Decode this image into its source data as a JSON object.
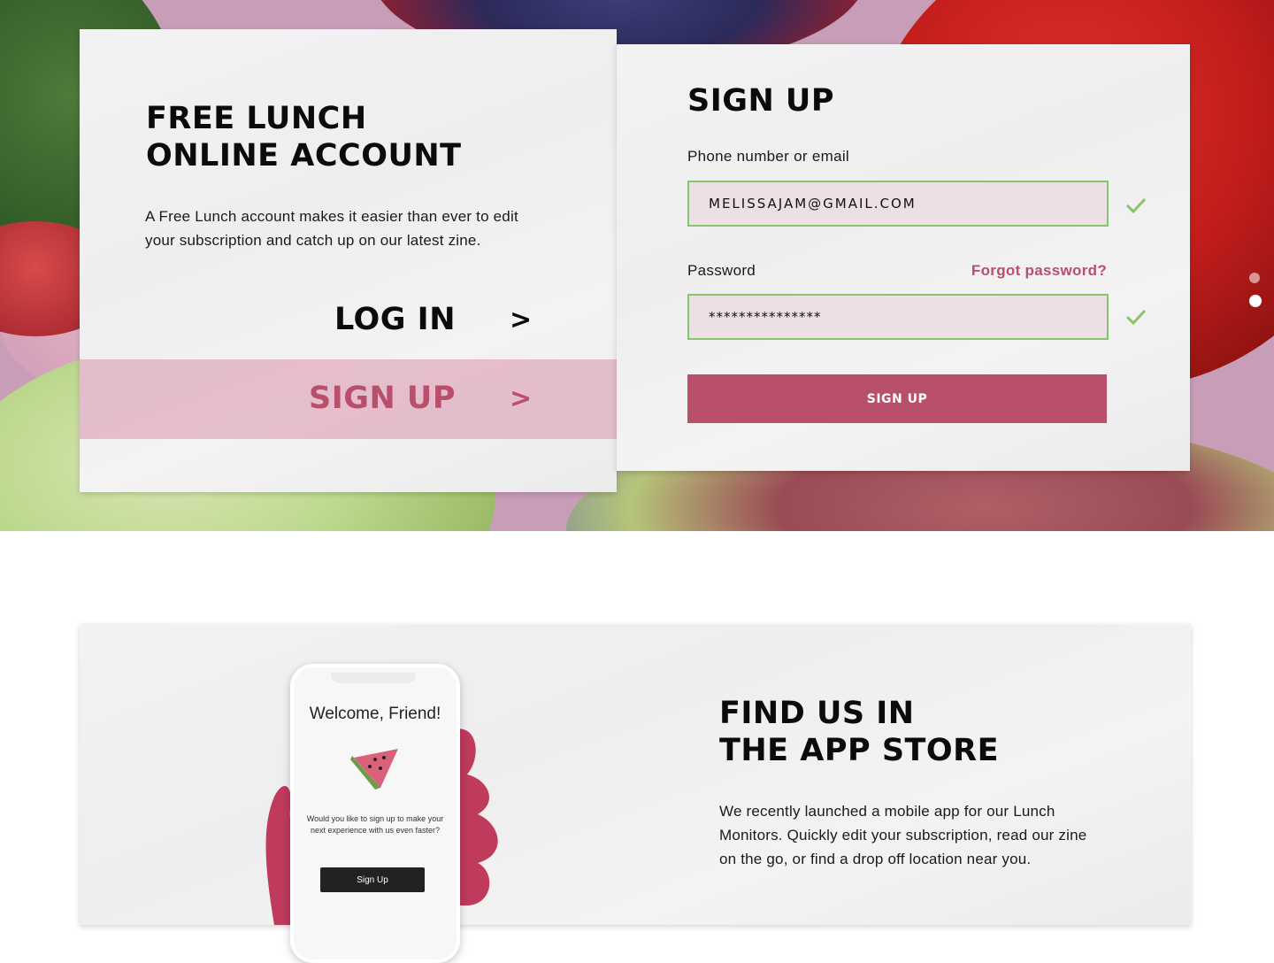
{
  "account_card": {
    "title_line1": "FREE LUNCH",
    "title_line2": "ONLINE ACCOUNT",
    "description": "A Free Lunch account makes it easier than ever to edit your subscription and catch up on our latest zine.",
    "login_label": "LOG IN",
    "signup_label": "SIGN UP",
    "arrow": ">"
  },
  "signup_form": {
    "title": "SIGN UP",
    "email_label": "Phone number or email",
    "email_value": "MELISSAJAM@GMAIL.COM",
    "password_label": "Password",
    "forgot_label": "Forgot password?",
    "password_value": "***************",
    "submit_label": "SIGN UP",
    "valid_color": "#8ac46a"
  },
  "app_section": {
    "title_line1": "FIND US IN",
    "title_line2": "THE APP STORE",
    "description": "We recently launched a mobile app for our Lunch Monitors. Quickly edit your subscription, read our zine on the go, or find a drop off location near you.",
    "phone_title": "Welcome, Friend!",
    "phone_copy": "Would you like to sign up to make your next experience with us even faster?",
    "phone_button": "Sign Up"
  },
  "carousel": {
    "slides": 2,
    "active_index": 1
  },
  "colors": {
    "accent": "#b8506b",
    "accent_tint": "#e2b4c6",
    "field_bg": "#ecdfe5"
  }
}
